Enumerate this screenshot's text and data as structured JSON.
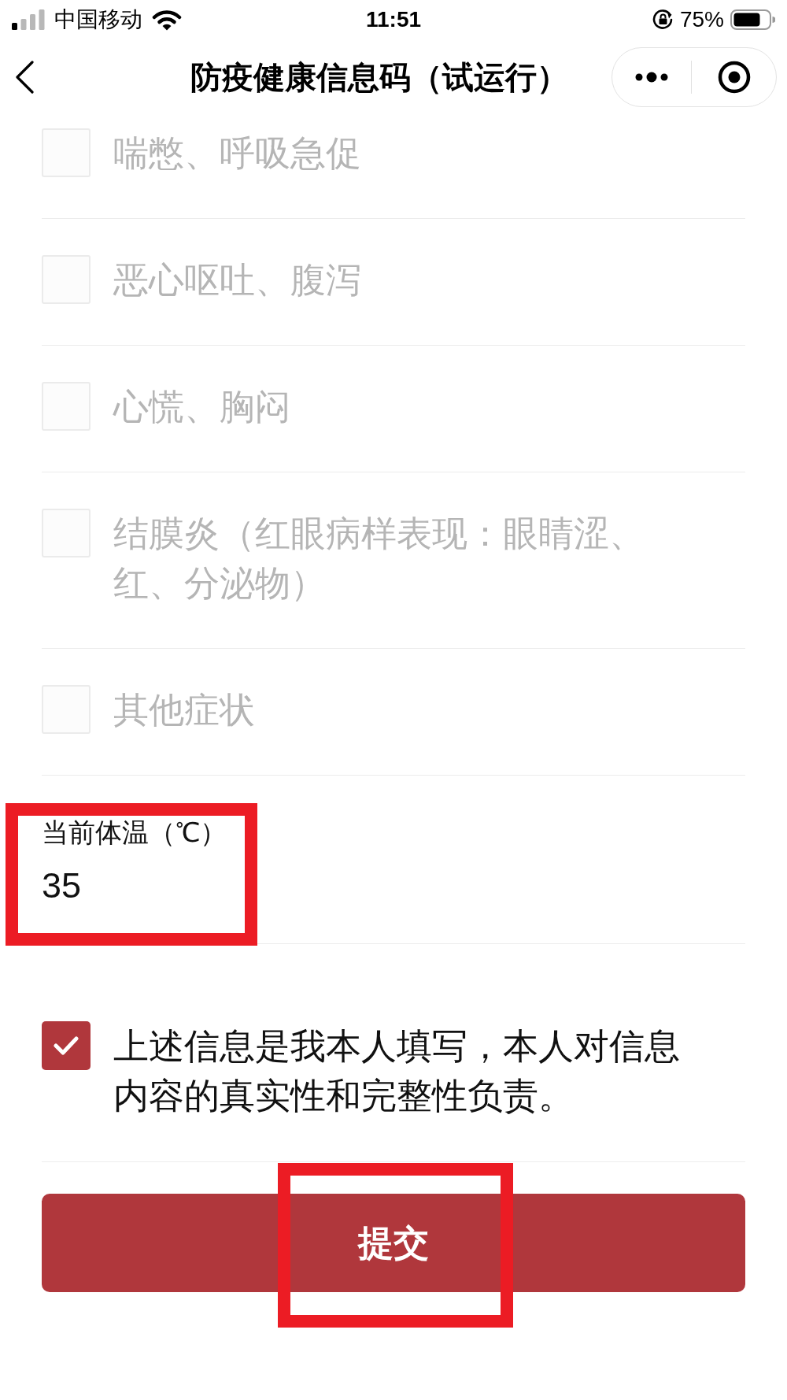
{
  "status_bar": {
    "carrier": "中国移动",
    "time": "11:51",
    "battery": "75%"
  },
  "nav_bar": {
    "title": "防疫健康信息码（试运行）"
  },
  "symptoms": [
    {
      "label": "喘憋、呼吸急促",
      "checked": false
    },
    {
      "label": "恶心呕吐、腹泻",
      "checked": false
    },
    {
      "label": "心慌、胸闷",
      "checked": false
    },
    {
      "label": "结膜炎（红眼病样表现：眼睛涩、红、分泌物）",
      "checked": false
    },
    {
      "label": "其他症状",
      "checked": false
    }
  ],
  "temperature": {
    "label": "当前体温（℃）",
    "value": "35",
    "highlighted": true
  },
  "declaration": {
    "text": "上述信息是我本人填写，本人对信息内容的真实性和完整性负责。",
    "checked": true
  },
  "submit_button": {
    "label": "提交",
    "highlighted": true
  }
}
